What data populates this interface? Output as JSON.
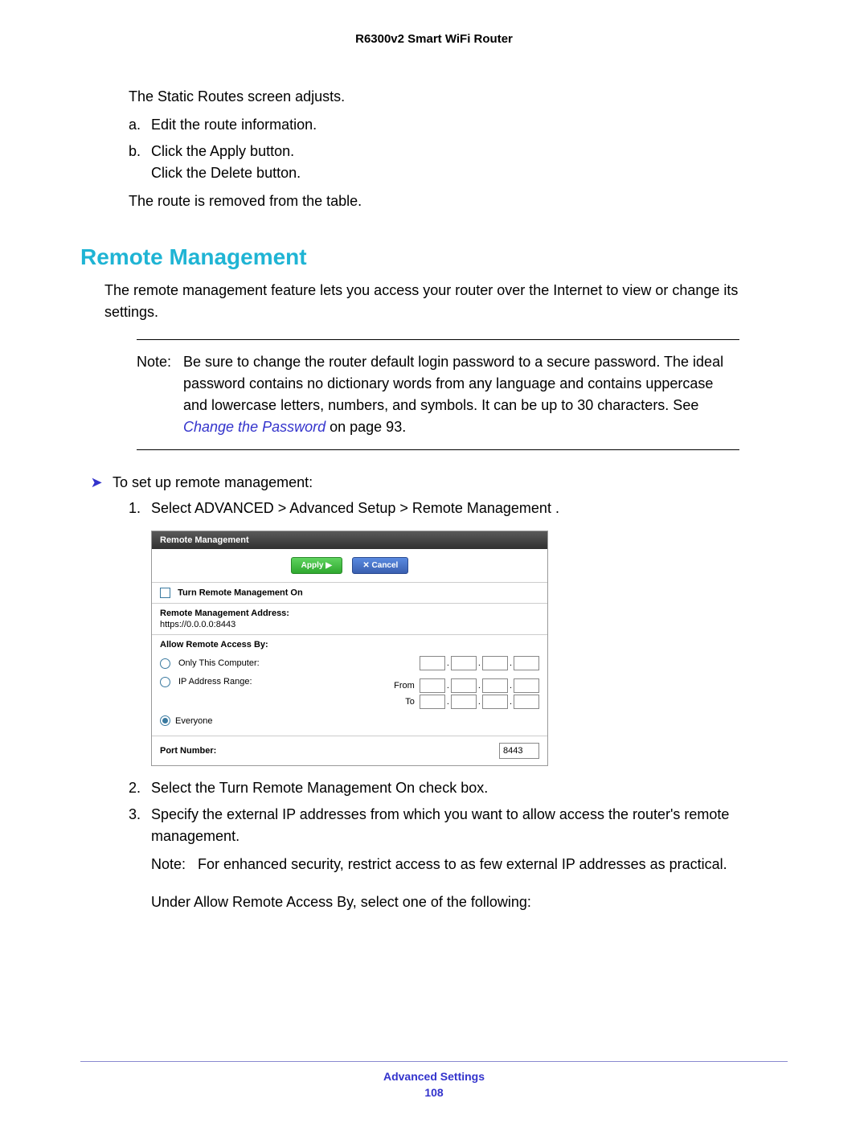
{
  "header": {
    "title": "R6300v2 Smart WiFi Router"
  },
  "top": {
    "line1": "The Static Routes screen adjusts.",
    "a": "Edit the route information.",
    "b": "Click the Apply button.",
    "b2": "Click the Delete button.",
    "line2": "The route is removed from the table."
  },
  "section": {
    "heading": "Remote Management",
    "intro": "The remote management feature lets you access your router over the Internet to view or change its settings."
  },
  "note1": {
    "label": "Note:",
    "text_a": "Be sure to change the router default login password to a secure password. The ideal password contains no dictionary words from any language and contains uppercase and lowercase letters, numbers, and symbols. It can be up to 30 characters. See ",
    "link": "Change the Password",
    "text_b": " on page 93."
  },
  "task": {
    "arrow": "➤",
    "title": "To set up remote management:"
  },
  "steps": {
    "s1": "Select ADVANCED > Advanced Setup > Remote Management   .",
    "s2": "Select the Turn Remote Management On check box.",
    "s3": "Specify the external IP addresses from which you want to allow access the router's remote management."
  },
  "note2": {
    "label": "Note:",
    "text": "For enhanced security, restrict access to as few external IP addresses as practical."
  },
  "under": "Under Allow Remote Access By, select one of the following:",
  "panel": {
    "title": "Remote Management",
    "apply": "Apply ▶",
    "cancel": "✕ Cancel",
    "turn_on": "Turn Remote Management On",
    "addr_label": "Remote Management Address:",
    "addr_value": "https://0.0.0.0:8443",
    "allow_label": "Allow Remote Access By:",
    "only_this": "Only This Computer:",
    "ip_range": "IP Address Range:",
    "from": "From",
    "to": "To",
    "everyone": "Everyone",
    "port_label": "Port Number:",
    "port_value": "8443"
  },
  "footer": {
    "section": "Advanced Settings",
    "page": "108"
  }
}
